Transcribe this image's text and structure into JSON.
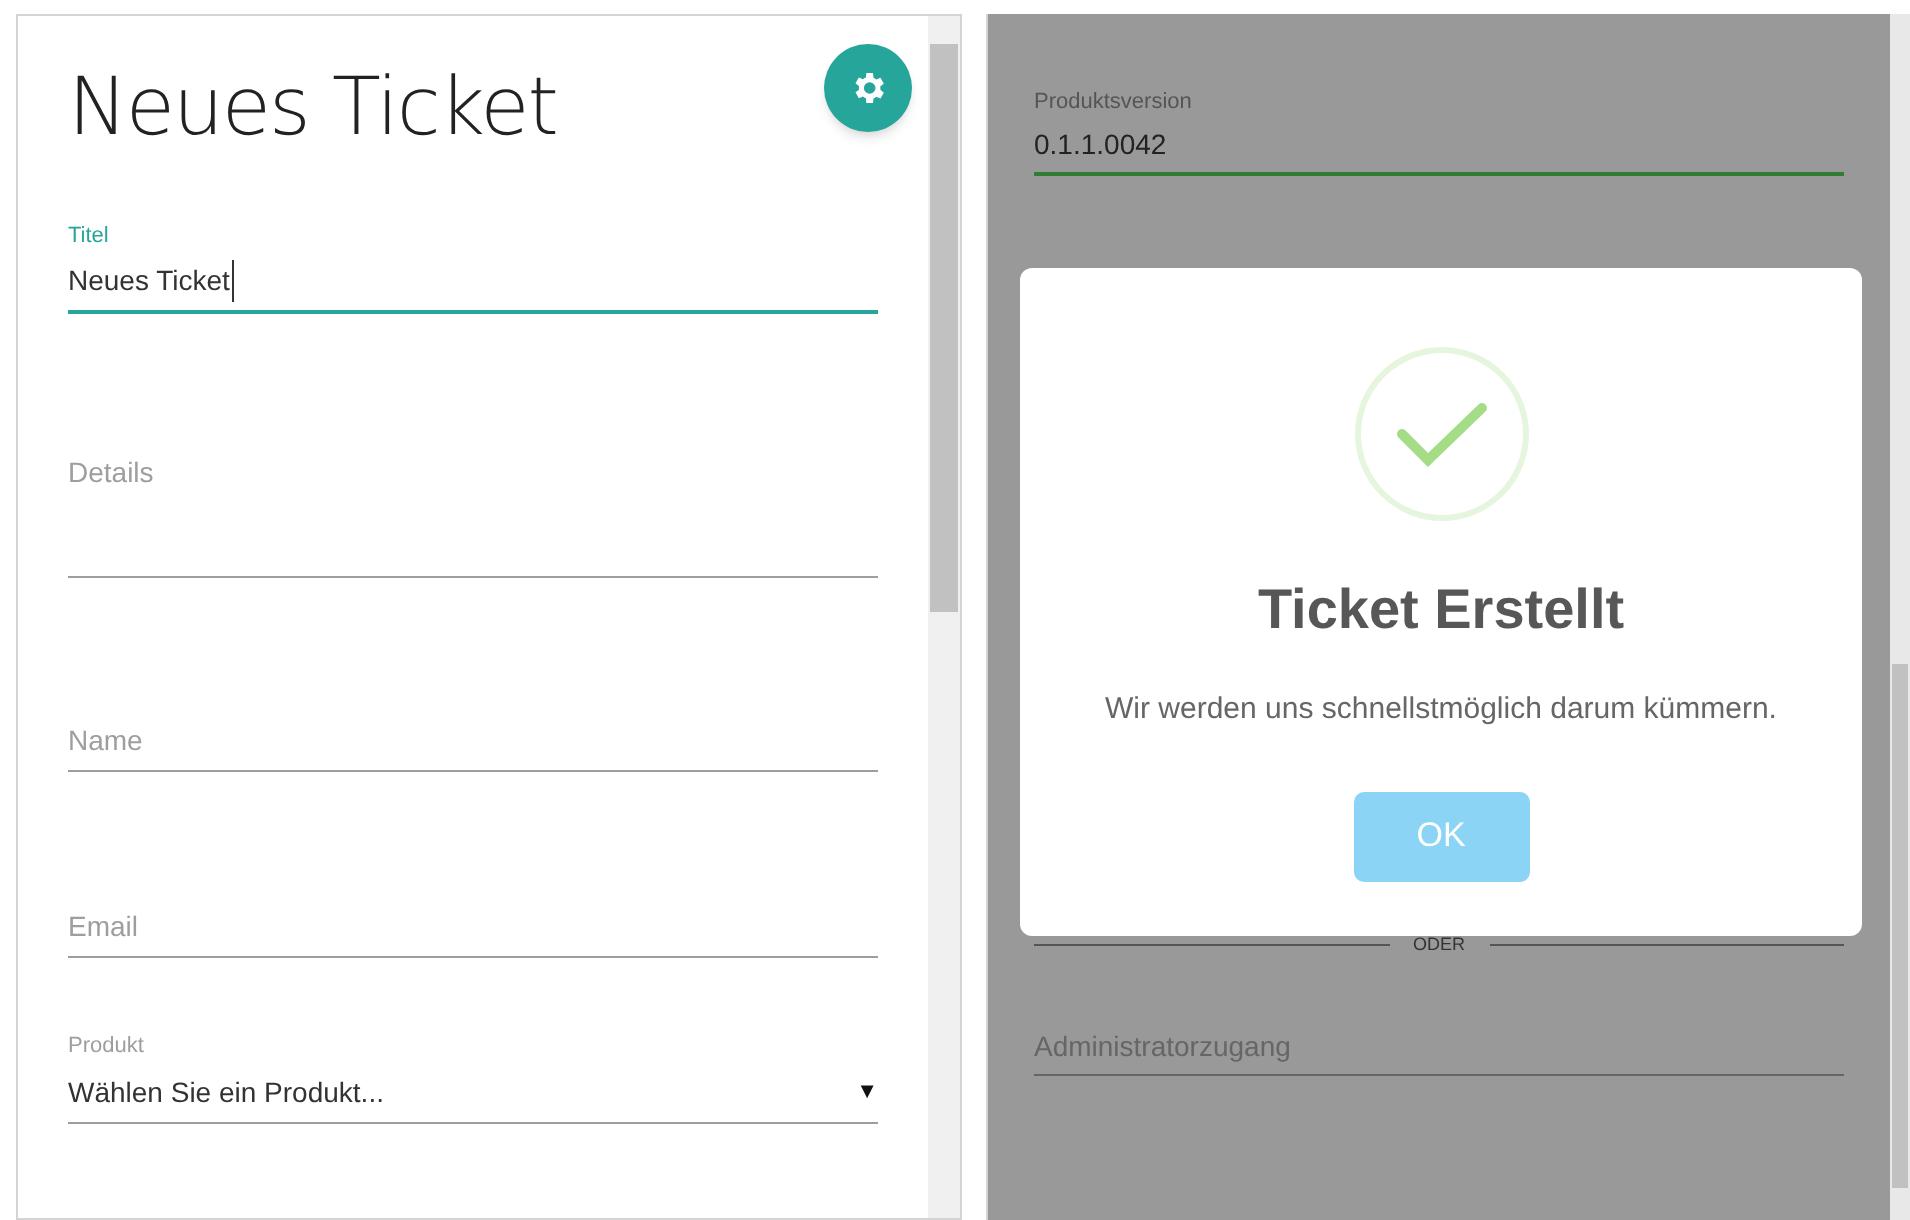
{
  "form": {
    "title": "Neues Ticket",
    "fields": [
      {
        "kind": "text",
        "label": "Titel",
        "value": "Neues Ticket",
        "focused": true
      },
      {
        "kind": "textarea",
        "placeholder": "Details",
        "focused": false
      },
      {
        "kind": "text",
        "placeholder": "Name",
        "focused": false
      },
      {
        "kind": "text",
        "placeholder": "Email",
        "focused": false
      },
      {
        "kind": "select",
        "label": "Produkt",
        "value": "Wählen Sie ein Produkt...",
        "arrow": "▼",
        "focused": false
      }
    ]
  },
  "background_form": {
    "version_label": "Produktsversion",
    "version_value": "0.1.1.0042",
    "divider_text": "ODER",
    "admin_placeholder": "Administratorzugang"
  },
  "dialog": {
    "title": "Ticket Erstellt",
    "message": "Wir werden uns schnellstmöglich darum kümmern.",
    "button": "OK"
  }
}
